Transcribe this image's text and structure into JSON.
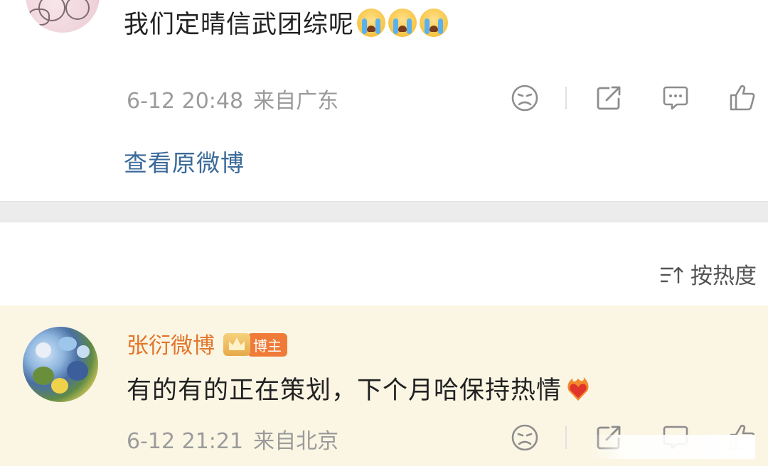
{
  "first_comment": {
    "text": "我们定晴信武团综呢",
    "emoji_count": 3,
    "emoji_name": "crying-face",
    "date": "6-12 20:48",
    "location": "来自广东",
    "view_original_label": "查看原微博"
  },
  "sort": {
    "label": "按热度",
    "icon": "sort-lines-icon"
  },
  "reply": {
    "username": "张衍微博",
    "badge": "博主",
    "text": "有的有的正在策划，下个月哈保持热情",
    "emoji_name": "heart-on-fire",
    "date": "6-12 21:21",
    "location": "来自北京"
  },
  "colors": {
    "username": "#e2762c",
    "link": "#3b6a9a",
    "meta": "#9b9b9b",
    "highlight_bg": "#fbf6e4",
    "separator": "#ececec"
  }
}
